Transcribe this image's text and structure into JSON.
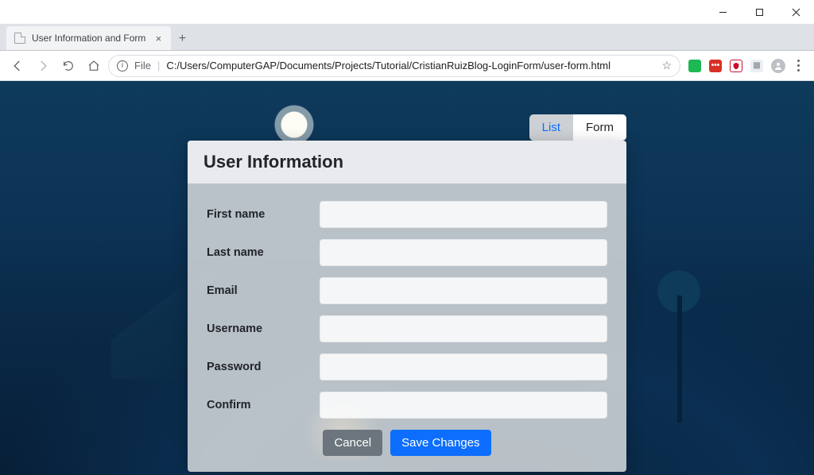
{
  "window": {
    "tab_title": "User Information and Form"
  },
  "addressbar": {
    "scheme_label": "File",
    "url": "C:/Users/ComputerGAP/Documents/Projects/Tutorial/CristianRuizBlog-LoginForm/user-form.html"
  },
  "nav_pills": {
    "list": "List",
    "form": "Form"
  },
  "card": {
    "title": "User Information",
    "fields": {
      "first_name": {
        "label": "First name",
        "value": ""
      },
      "last_name": {
        "label": "Last name",
        "value": ""
      },
      "email": {
        "label": "Email",
        "value": ""
      },
      "username": {
        "label": "Username",
        "value": ""
      },
      "password": {
        "label": "Password",
        "value": ""
      },
      "confirm": {
        "label": "Confirm",
        "value": ""
      }
    },
    "buttons": {
      "cancel": "Cancel",
      "save": "Save Changes"
    }
  },
  "ext_colors": {
    "green": "#1db954",
    "red": "#d93025",
    "mcafee": "#c8102e",
    "grey": "#bdc1c6"
  }
}
